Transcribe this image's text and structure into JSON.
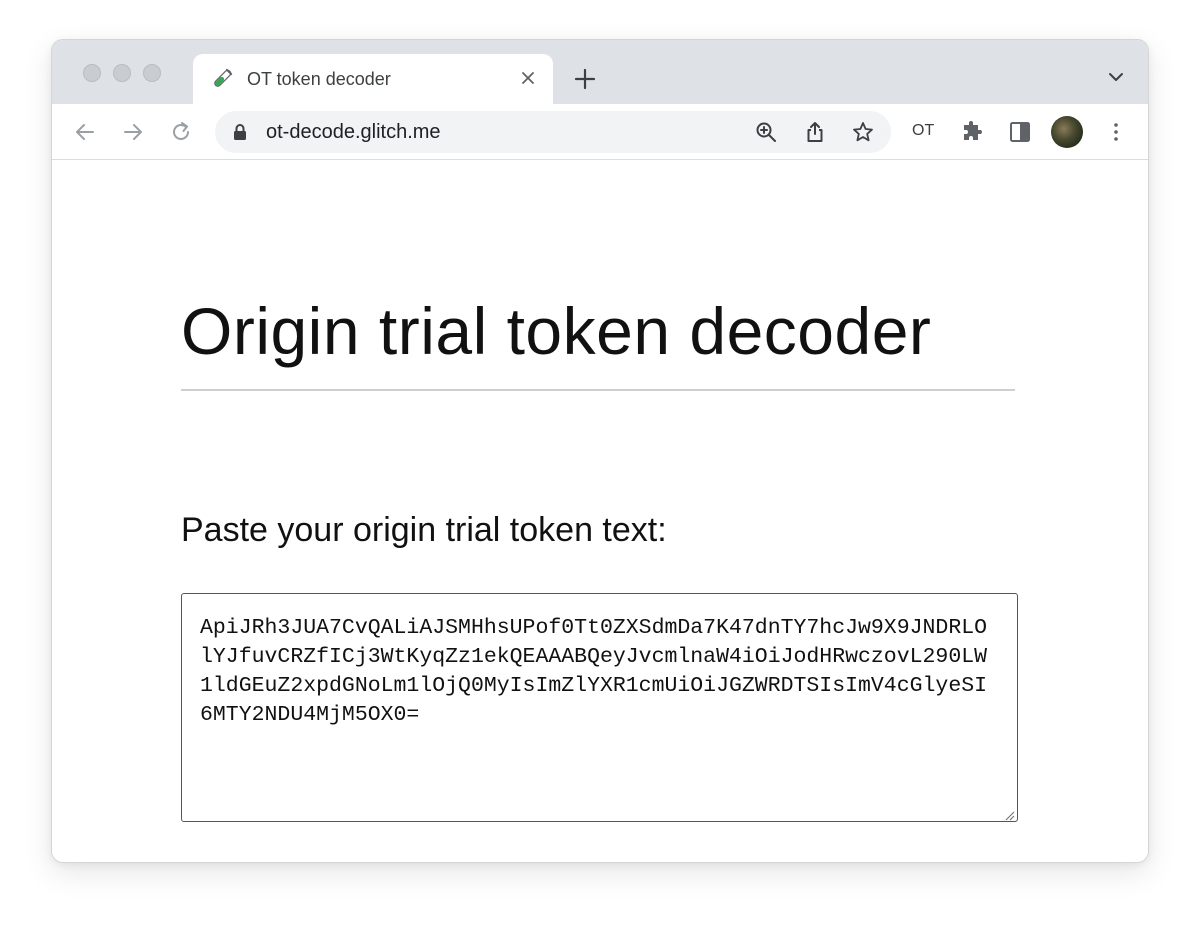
{
  "browser": {
    "tab": {
      "title": "OT token decoder",
      "favicon": "test-tube-icon"
    },
    "address_bar": {
      "url": "ot-decode.glitch.me"
    },
    "extension_label": "OT"
  },
  "page": {
    "title": "Origin trial token decoder",
    "prompt_label": "Paste your origin trial token text:",
    "token_value": "ApiJRh3JUA7CvQALiAJSMHhsUPof0Tt0ZXSdmDa7K47dnTY7hcJw9X9JNDRLOlYJfuvCRZfICj3WtKyqZz1ekQEAAABQeyJvcmlnaW4iOiJodHRwczovL290LW1ldGEuZ2xpdGNoLm1lOjQ0MyIsImZlYXR1cmUiOiJGZWRDTSIsImV4cGlyeSI6MTY2NDU4MjM5OX0="
  },
  "colors": {
    "tabstrip": "#dee1e6",
    "omnibox": "#f1f3f4",
    "text": "#111111"
  }
}
